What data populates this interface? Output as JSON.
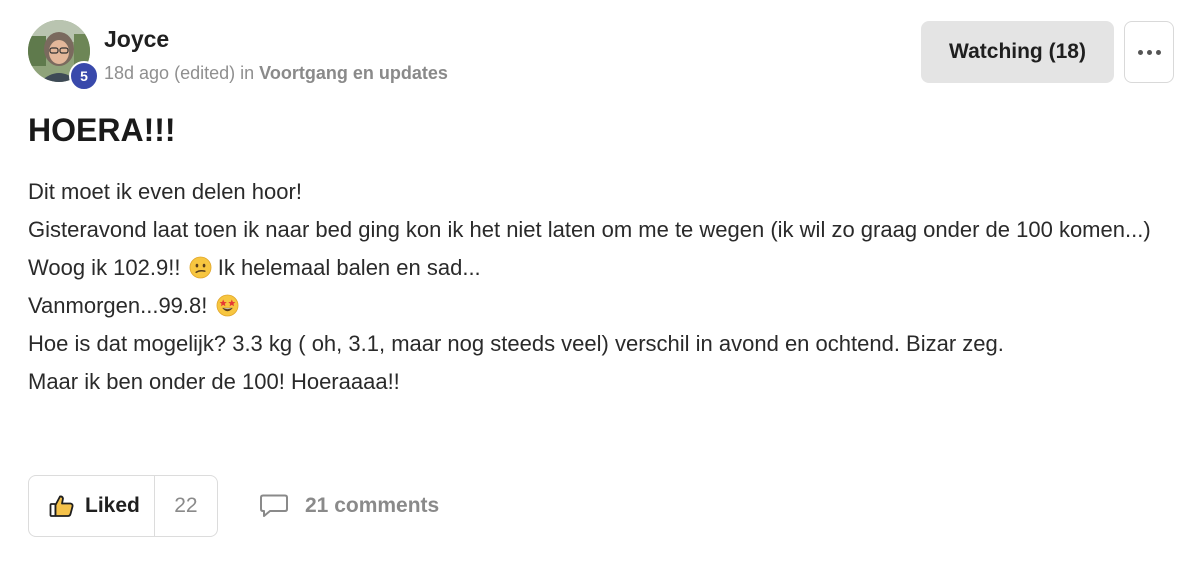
{
  "post": {
    "author": {
      "name": "Joyce",
      "level": "5"
    },
    "meta": {
      "time": "18d ago",
      "edited": "(edited)",
      "in_word": "in",
      "category": "Voortgang en updates"
    },
    "watch_button_label": "Watching (18)",
    "title": "HOERA!!!",
    "body_lines": [
      "Dit moet ik even delen hoor!",
      "Gisteravond laat toen ik naar bed ging kon ik het niet laten om me te wegen (ik wil zo graag onder de 100 komen...)",
      "Woog ik 102.9!!",
      "Ik helemaal balen en sad...",
      "Vanmorgen...99.8!",
      "Hoe is dat mogelijk? 3.3 kg ( oh, 3.1, maar nog steeds veel) verschil in avond en ochtend. Bizar zeg.",
      "Maar ik ben onder de 100! Hoeraaaa!!"
    ],
    "emojis": [
      "confused-face",
      "star-struck-face"
    ],
    "footer": {
      "like_label": "Liked",
      "like_count": "22",
      "comments_label": "21 comments"
    }
  },
  "colors": {
    "badge": "#3949ab",
    "watch_button_bg": "#e4e4e4",
    "muted_text": "#8a8a8a"
  }
}
